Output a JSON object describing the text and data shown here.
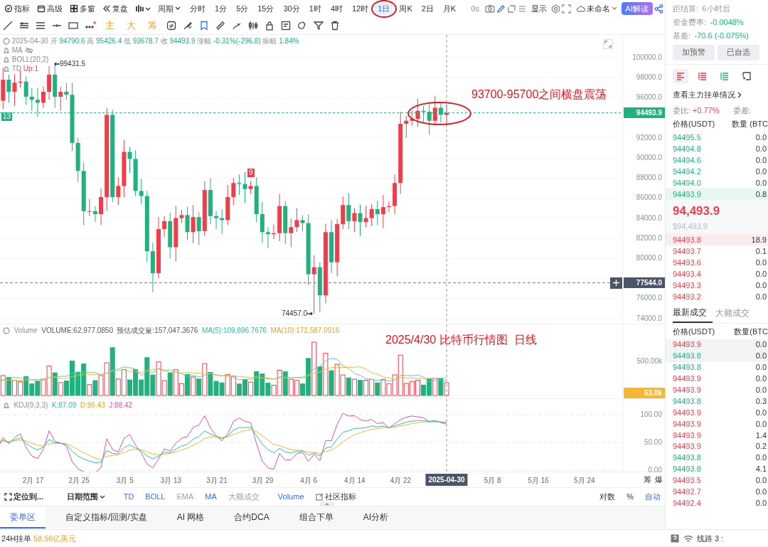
{
  "toolbar": {
    "tools": [
      {
        "label": "指标"
      },
      {
        "label": "高级"
      },
      {
        "label": "多窗"
      },
      {
        "label": "复盘"
      }
    ],
    "period": "周期",
    "intervals": [
      {
        "label": "分时",
        "selected": false
      },
      {
        "label": "1分",
        "selected": false
      },
      {
        "label": "5分",
        "selected": false
      },
      {
        "label": "15分",
        "selected": false
      },
      {
        "label": "30分",
        "selected": false
      },
      {
        "label": "1时",
        "selected": false
      },
      {
        "label": "4时",
        "selected": false
      },
      {
        "label": "12时",
        "selected": false
      },
      {
        "label": "1日",
        "selected": true
      },
      {
        "label": "周K",
        "selected": false
      },
      {
        "label": "2日",
        "selected": false
      },
      {
        "label": "月K",
        "selected": false
      }
    ],
    "countdown": "0s",
    "display": "显示",
    "layout_name": "未命名",
    "ai_button": "AI解读"
  },
  "drawing_toolbar": {
    "text_tools": [
      "主",
      "大",
      "筹"
    ]
  },
  "price_chart": {
    "legend": {
      "date": "2025-04-30",
      "fields": [
        {
          "label": "开",
          "value": "94790.6"
        },
        {
          "label": "高",
          "value": "95426.4"
        },
        {
          "label": "低",
          "value": "93678.7"
        },
        {
          "label": "收",
          "value": "94493.9"
        },
        {
          "label": "涨幅",
          "value": "-0.31%(-296.8)"
        },
        {
          "label": "振幅",
          "value": "1.84%"
        }
      ]
    },
    "indicators": [
      {
        "name": "MA"
      },
      {
        "name": "BOLL(20,2)"
      },
      {
        "name": "TD",
        "value": "Up:1"
      }
    ],
    "axis_labels": [
      "100000.0",
      "98000.0",
      "96000.0",
      "92000.0",
      "90000.0",
      "88000.0",
      "86000.0",
      "84000.0",
      "82000.0",
      "80000.0",
      "76000.0",
      "74000.0"
    ],
    "last_price": "94493.9",
    "crosshair_price": "77544.0",
    "high_marker": "99431.5",
    "low_marker": "74457.0",
    "left_tag": "13",
    "candle_tag": "9",
    "annotation": "93700-95700之间横盘震荡"
  },
  "volume_chart": {
    "title": "Volume",
    "fields": [
      {
        "kind": "plain",
        "text": "VOLUME:62,977.0850"
      },
      {
        "kind": "plain",
        "text": "预估成交量:157,047.3676"
      },
      {
        "kind": "ma5",
        "text": "MA(5):109,896.7676"
      },
      {
        "kind": "ma10",
        "text": "MA(10):172,587.0916"
      }
    ],
    "axis_label": "500.00k",
    "current_tag": "63.0k",
    "annotation": "2025/4/30 比特币行情图  日线"
  },
  "kdj_chart": {
    "title": "KDJ(9,3,3)",
    "fields": [
      {
        "kind": "k",
        "text": "K:87.09"
      },
      {
        "kind": "d",
        "text": "D:86.43"
      },
      {
        "kind": "j",
        "text": "J:88.42"
      }
    ],
    "axis_labels": [
      "100.00",
      "50.00",
      "0.00"
    ]
  },
  "x_axis": {
    "labels": [
      {
        "text": "2月 17",
        "kind": "tick"
      },
      {
        "text": "2月 25",
        "kind": "tick"
      },
      {
        "text": "3月 5",
        "kind": "tick"
      },
      {
        "text": "3月 13",
        "kind": "tick"
      },
      {
        "text": "3月 21",
        "kind": "tick"
      },
      {
        "text": "3月 29",
        "kind": "tick"
      },
      {
        "text": "4月 6",
        "kind": "tick"
      },
      {
        "text": "4月 14",
        "kind": "tick"
      },
      {
        "text": "4月 22",
        "kind": "tick"
      },
      {
        "text": "2025-04-30",
        "kind": "crosshair"
      },
      {
        "text": "5月 8",
        "kind": "tick"
      },
      {
        "text": "5月 16",
        "kind": "tick"
      },
      {
        "text": "5月 24",
        "kind": "tick"
      }
    ],
    "side_labels": [
      "筹",
      "爆"
    ]
  },
  "indicator_bar": {
    "locate": "定位到...",
    "date_range": "日期范围",
    "toggles": [
      {
        "label": "TD",
        "active": true
      },
      {
        "label": "BOLL",
        "active": true
      },
      {
        "label": "EMA",
        "active": false
      },
      {
        "label": "MA",
        "active": true
      },
      {
        "label": "大额成交",
        "active": false
      },
      {
        "label": "Volume",
        "active": true
      }
    ],
    "community": "社区指标",
    "scale_options": [
      {
        "label": "对数",
        "active": false
      },
      {
        "label": "%",
        "active": false
      },
      {
        "label": "自动",
        "active": true
      }
    ]
  },
  "bottom_tabs": [
    {
      "label": "委单区",
      "selected": true
    },
    {
      "label": "自定义指标/回测/实盘",
      "selected": false
    },
    {
      "label": "AI 网格",
      "selected": false
    },
    {
      "label": "合约DCA",
      "selected": false
    },
    {
      "label": "组合下单",
      "selected": false
    },
    {
      "label": "AI分析",
      "selected": false
    }
  ],
  "status_bar": {
    "label": "24H挂单",
    "value": "58.56亿美元",
    "line": "线路 3 :"
  },
  "side_panel": {
    "info": [
      {
        "label": "距结算:",
        "value": "6小时后",
        "kind": "plain"
      },
      {
        "label": "资金费率:",
        "value": "-0.0048%",
        "kind": "down"
      },
      {
        "label": "基差:",
        "value": "-70.6 (-0.075%)",
        "kind": "down"
      }
    ],
    "buttons": [
      "加预警",
      "已自选"
    ],
    "view_tabs": [
      {
        "selected": true
      },
      {
        "selected": false
      },
      {
        "selected": false
      },
      {
        "selected": false
      }
    ],
    "depth_link": "查看主力挂单情况",
    "ratio": {
      "label": "委比:",
      "value": "+0.77%"
    },
    "diff_label": "委差:",
    "book_columns": [
      "价格(USDT)",
      "数量 (BTC"
    ],
    "asks": [
      {
        "price": "94495.5",
        "qty": "0.0",
        "highlighted": false
      },
      {
        "price": "94494.8",
        "qty": "0.0",
        "highlighted": false
      },
      {
        "price": "94494.6",
        "qty": "0.0",
        "highlighted": false
      },
      {
        "price": "94494.2",
        "qty": "0.0",
        "highlighted": false
      },
      {
        "price": "94494.0",
        "qty": "0.0",
        "highlighted": false
      },
      {
        "price": "94493.9",
        "qty": "0.8",
        "highlighted": true
      }
    ],
    "mid": {
      "price": "94,493.9",
      "usd": "$94,493.9"
    },
    "bids": [
      {
        "price": "94493.8",
        "qty": "18.9",
        "highlighted": true
      },
      {
        "price": "94493.7",
        "qty": "0.1",
        "highlighted": false
      },
      {
        "price": "94493.6",
        "qty": "0.0",
        "highlighted": false
      },
      {
        "price": "94493.4",
        "qty": "0.0",
        "highlighted": false
      },
      {
        "price": "94493.3",
        "qty": "0.0",
        "highlighted": false
      },
      {
        "price": "94493.2",
        "qty": "0.0",
        "highlighted": false
      }
    ],
    "trade_tabs": [
      {
        "label": "最新成交",
        "selected": true
      },
      {
        "label": "大额成交",
        "selected": false
      }
    ],
    "trade_columns": [
      "价格(USDT)",
      "数量(BTC"
    ],
    "trades": [
      {
        "price": "94493.9",
        "qty": "0.0",
        "color": "#f23c4a"
      },
      {
        "price": "94493.8",
        "qty": "0.0",
        "color": "#20b27e"
      },
      {
        "price": "94493.8",
        "qty": "0.0",
        "color": "#20b27e"
      },
      {
        "price": "94493.9",
        "qty": "0.0",
        "color": "#f23c4a"
      },
      {
        "price": "94493.9",
        "qty": "0.0",
        "color": "#f23c4a"
      },
      {
        "price": "94493.8",
        "qty": "0.3",
        "color": "#20b27e"
      },
      {
        "price": "94493.9",
        "qty": "0.0",
        "color": "#f23c4a"
      },
      {
        "price": "94493.9",
        "qty": "0.0",
        "color": "#f23c4a"
      },
      {
        "price": "94493.9",
        "qty": "1.4",
        "color": "#f23c4a"
      },
      {
        "price": "94493.9",
        "qty": "0.2",
        "color": "#f23c4a"
      },
      {
        "price": "94493.8",
        "qty": "0.0",
        "color": "#20b27e"
      },
      {
        "price": "94493.8",
        "qty": "4.1",
        "color": "#20b27e"
      },
      {
        "price": "94493.5",
        "qty": "0.0",
        "color": "#f23c4a"
      },
      {
        "price": "94492.7",
        "qty": "0.0",
        "color": "#f23c4a"
      },
      {
        "price": "94492.4",
        "qty": "0.0",
        "color": "#f23c4a"
      }
    ]
  }
}
